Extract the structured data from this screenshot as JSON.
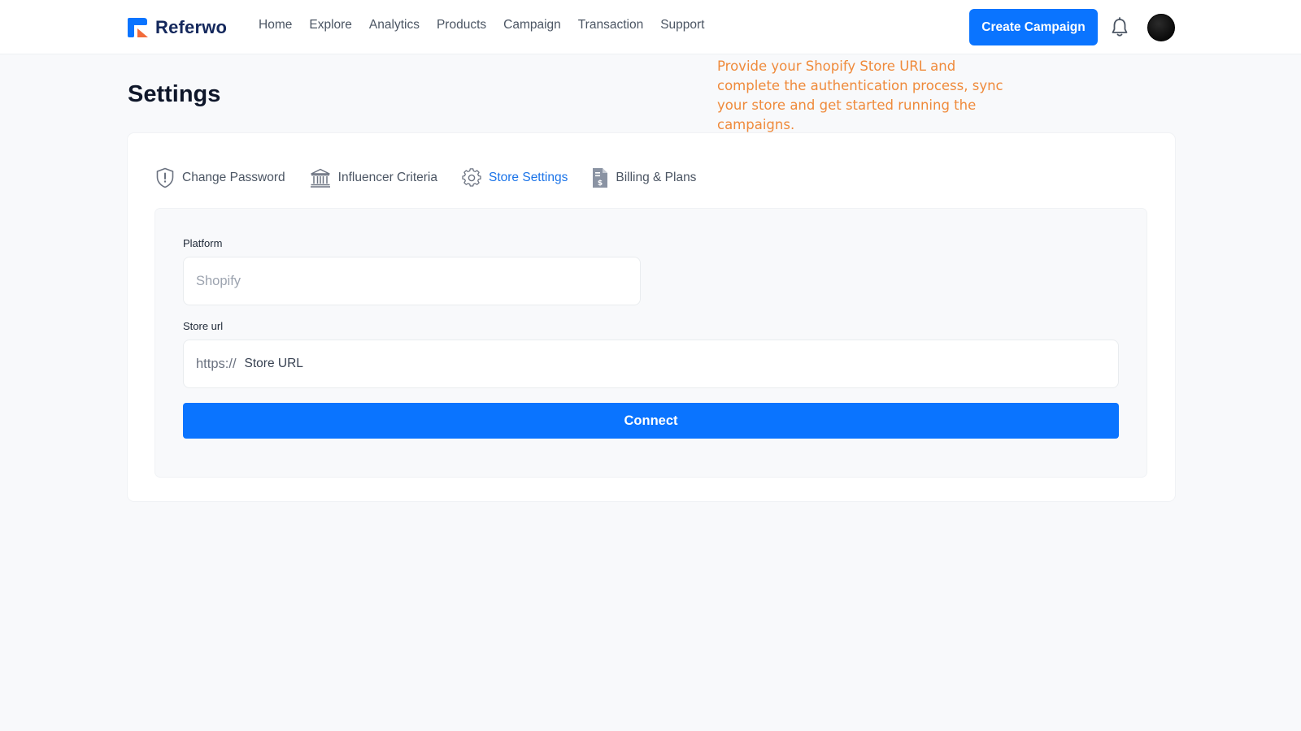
{
  "brand": {
    "name": "Referwo",
    "colors": {
      "primary": "#0a74ff",
      "accent": "#f26b3a",
      "dark": "#14285c"
    }
  },
  "nav": {
    "items": [
      {
        "label": "Home"
      },
      {
        "label": "Explore"
      },
      {
        "label": "Analytics"
      },
      {
        "label": "Products"
      },
      {
        "label": "Campaign"
      },
      {
        "label": "Transaction"
      },
      {
        "label": "Support"
      }
    ],
    "create_label": "Create Campaign",
    "bell_icon": "bell-icon",
    "avatar_icon": "user-avatar"
  },
  "annotation": {
    "text": "Provide your Shopify Store URL and complete the authentication process, sync your store and get started running the campaigns.",
    "color": "#ef8a3b"
  },
  "page": {
    "title": "Settings"
  },
  "tabs": [
    {
      "label": "Change Password",
      "icon": "shield-alert-icon",
      "active": false
    },
    {
      "label": "Influencer Criteria",
      "icon": "bank-building-icon",
      "active": false
    },
    {
      "label": "Store Settings",
      "icon": "gear-icon",
      "active": true
    },
    {
      "label": "Billing & Plans",
      "icon": "invoice-dollar-icon",
      "active": false
    }
  ],
  "form": {
    "platform_label": "Platform",
    "platform_placeholder": "Shopify",
    "store_url_label": "Store url",
    "store_url_prefix": "https://",
    "store_url_placeholder": "Store URL",
    "connect_label": "Connect"
  }
}
